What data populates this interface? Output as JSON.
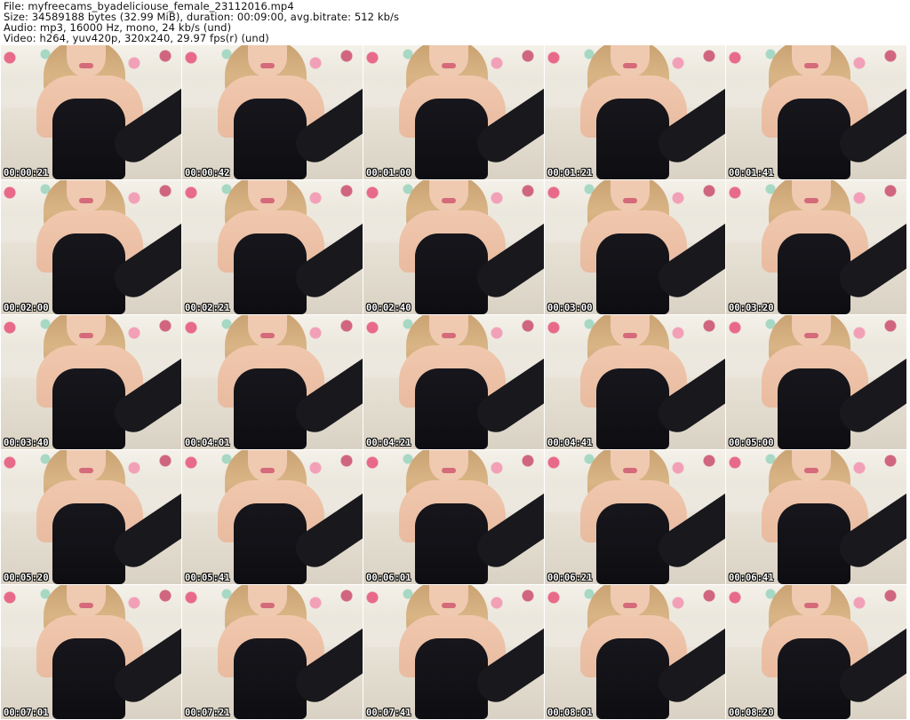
{
  "header": {
    "file_line": "File: myfreecams_byadeliciouse_female_23112016.mp4",
    "size_line": "Size: 34589188 bytes (32.99 MiB), duration: 00:09:00, avg.bitrate: 512 kb/s",
    "audio_line": "Audio: mp3, 16000 Hz, mono, 24 kb/s (und)",
    "video_line": "Video: h264, yuv420p, 320x240, 29.97 fps(r) (und)"
  },
  "thumbnails": [
    {
      "timestamp": "00:00:21"
    },
    {
      "timestamp": "00:00:42"
    },
    {
      "timestamp": "00:01:00"
    },
    {
      "timestamp": "00:01:21"
    },
    {
      "timestamp": "00:01:41"
    },
    {
      "timestamp": "00:02:00"
    },
    {
      "timestamp": "00:02:21"
    },
    {
      "timestamp": "00:02:40"
    },
    {
      "timestamp": "00:03:00"
    },
    {
      "timestamp": "00:03:20"
    },
    {
      "timestamp": "00:03:40"
    },
    {
      "timestamp": "00:04:01"
    },
    {
      "timestamp": "00:04:21"
    },
    {
      "timestamp": "00:04:41"
    },
    {
      "timestamp": "00:05:00"
    },
    {
      "timestamp": "00:05:20"
    },
    {
      "timestamp": "00:05:41"
    },
    {
      "timestamp": "00:06:01"
    },
    {
      "timestamp": "00:06:21"
    },
    {
      "timestamp": "00:06:41"
    },
    {
      "timestamp": "00:07:01"
    },
    {
      "timestamp": "00:07:21"
    },
    {
      "timestamp": "00:07:41"
    },
    {
      "timestamp": "00:08:01"
    },
    {
      "timestamp": "00:08:20"
    }
  ]
}
